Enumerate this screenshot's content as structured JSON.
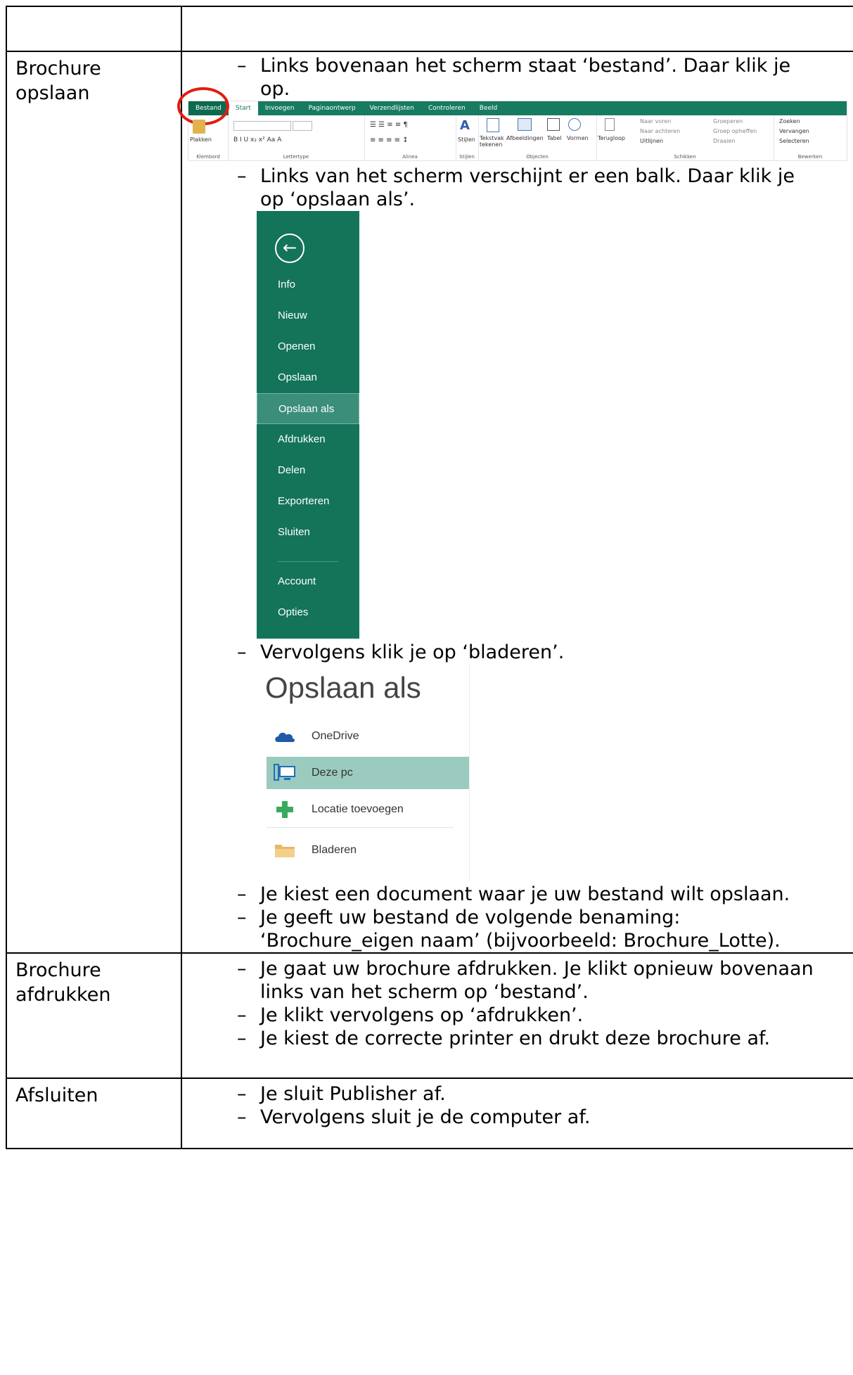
{
  "rows": [
    {
      "label": "Brochure opslaan",
      "bullets": {
        "b1": "Links bovenaan het scherm staat ‘bestand’. Daar klik je op.",
        "b2": "Links van het scherm verschijnt er een balk. Daar klik je op ‘opslaan als’.",
        "b3": "Vervolgens klik je op ‘bladeren’.",
        "b4": "Je kiest een document waar je uw bestand wilt opslaan.",
        "b5": "Je geeft uw bestand de volgende benaming: ‘Brochure_eigen naam’ (bijvoorbeeld: Brochure_Lotte)."
      }
    },
    {
      "label": "Brochure afdrukken",
      "bullets": [
        "Je gaat uw brochure afdrukken. Je klikt opnieuw bovenaan links van het scherm op ‘bestand’.",
        "Je klikt vervolgens op ‘afdrukken’.",
        "Je kiest de correcte printer en drukt deze brochure af."
      ]
    },
    {
      "label": "Afsluiten",
      "bullets": [
        "Je sluit Publisher af.",
        "Vervolgens sluit je de computer af."
      ]
    }
  ],
  "dash": "–",
  "ribbon": {
    "tabs": [
      "Bestand",
      "Start",
      "Invoegen",
      "Paginaontwerp",
      "Verzendlijsten",
      "Controleren",
      "Beeld"
    ],
    "groups": [
      "Klembord",
      "Lettertype",
      "Alinea",
      "Stijlen",
      "Objecten",
      "Schikken",
      "Bewerken"
    ],
    "buttons": {
      "plakken": "Plakken",
      "stijlen": "Stijlen",
      "tekstvak": "Tekstvak tekenen",
      "afbeeldingen": "Afbeeldingen",
      "tabel": "Tabel",
      "vormen": "Vormen",
      "terugloop": "Terugloop",
      "naar_voren": "Naar voren",
      "naar_achteren": "Naar achteren",
      "uitlijnen": "Uitlijnen",
      "groeperen": "Groeperen",
      "groep_opheffen": "Groep opheffen",
      "draaien": "Draaien",
      "zoeken": "Zoeken",
      "vervangen": "Vervangen",
      "selecteren": "Selecteren"
    }
  },
  "backstage": {
    "items": [
      "Info",
      "Nieuw",
      "Openen",
      "Opslaan",
      "Opslaan als",
      "Afdrukken",
      "Delen",
      "Exporteren",
      "Sluiten",
      "Account",
      "Opties"
    ],
    "selected": "Opslaan als"
  },
  "saveas": {
    "title": "Opslaan als",
    "locations": [
      "OneDrive",
      "Deze pc",
      "Locatie toevoegen",
      "Bladeren"
    ],
    "selected": "Deze pc"
  },
  "colors": {
    "green": "#137459",
    "selected_green": "#3b8e79",
    "highlight": "#9bcbbf",
    "ring": "#e41b13"
  }
}
